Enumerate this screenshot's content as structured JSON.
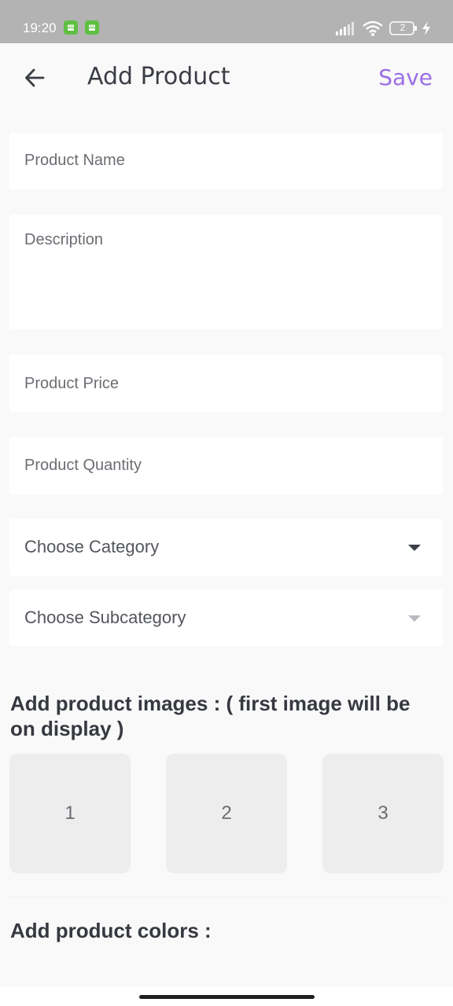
{
  "status_bar": {
    "time": "19:20",
    "battery_level": "2",
    "notification_icons": [
      "android-notification-icon",
      "android-notification-icon"
    ],
    "right_icons": [
      "signal-icon",
      "wifi-icon",
      "battery-icon",
      "charging-icon"
    ]
  },
  "header": {
    "title": "Add Product",
    "save_label": "Save",
    "back_icon": "arrow-left-icon"
  },
  "form": {
    "product_name_placeholder": "Product Name",
    "description_placeholder": "Description",
    "price_placeholder": "Product Price",
    "quantity_placeholder": "Product Quantity",
    "category_placeholder": "Choose Category",
    "subcategory_placeholder": "Choose Subcategory"
  },
  "images_section": {
    "heading": "Add product images : ( first image will be on display )",
    "slots": [
      "1",
      "2",
      "3"
    ]
  },
  "colors_section": {
    "heading": "Add product colors :"
  },
  "colors": {
    "accent": "#9b6ee6",
    "status_bar": "#b3b3b3",
    "background": "#f9f9f9",
    "field_background": "#ffffff",
    "image_slot": "#ededed",
    "dropdown_active": "#3a3d45",
    "dropdown_disabled": "#b8bac0"
  }
}
